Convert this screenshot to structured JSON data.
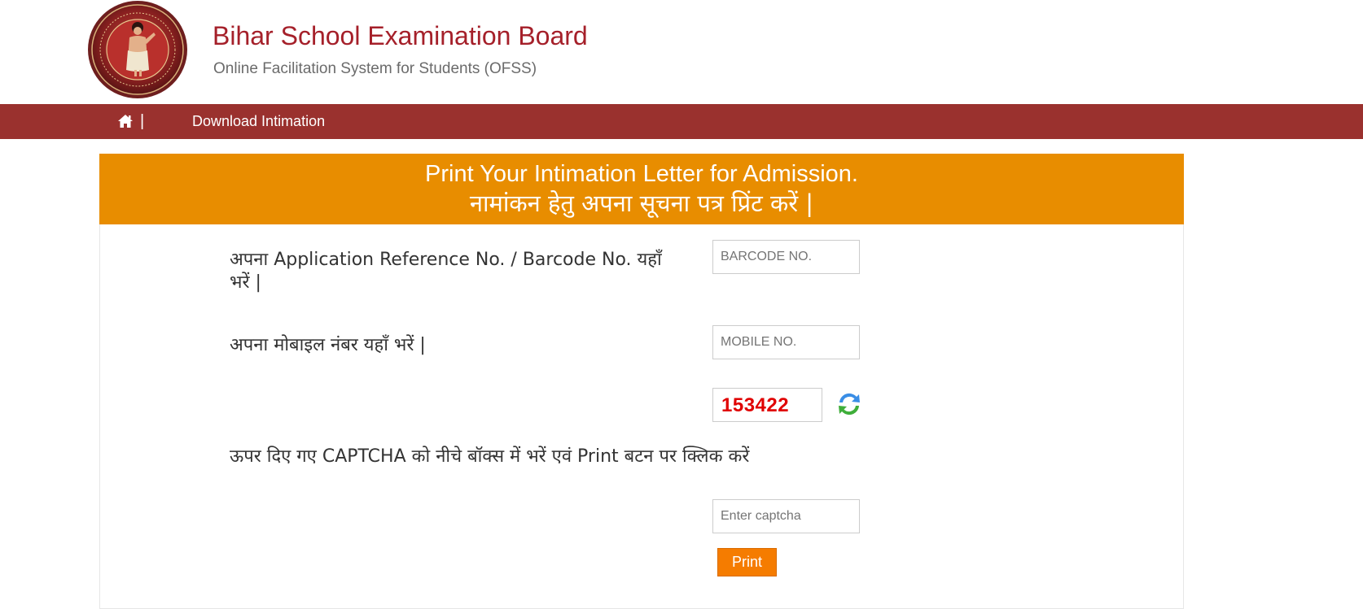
{
  "header": {
    "title": "Bihar School Examination Board",
    "subtitle": "Online Facilitation System for Students (OFSS)"
  },
  "nav": {
    "separator": "|",
    "link_label": "Download Intimation"
  },
  "banner": {
    "line_en": "Print Your Intimation Letter for Admission.",
    "line_hi": "नामांकन हेतु अपना सूचना पत्र प्रिंट करें |"
  },
  "form": {
    "barcode_label": "अपना Application Reference No. / Barcode No. यहाँ भरें |",
    "barcode_placeholder": "BARCODE NO.",
    "mobile_label": "अपना मोबाइल नंबर यहाँ भरें |",
    "mobile_placeholder": "MOBILE NO.",
    "captcha_code": "153422",
    "captcha_instruction": "ऊपर दिए गए CAPTCHA को नीचे बॉक्स में भरें एवं Print बटन पर क्लिक करें",
    "captcha_placeholder": "Enter captcha",
    "print_label": "Print"
  },
  "icons": {
    "home": "home-icon",
    "refresh": "refresh-icon"
  },
  "colors": {
    "title_red": "#a5202a",
    "nav_bar": "#9a312e",
    "banner_orange": "#e88d00",
    "button_orange": "#f57c00",
    "captcha_red": "#e00000"
  }
}
